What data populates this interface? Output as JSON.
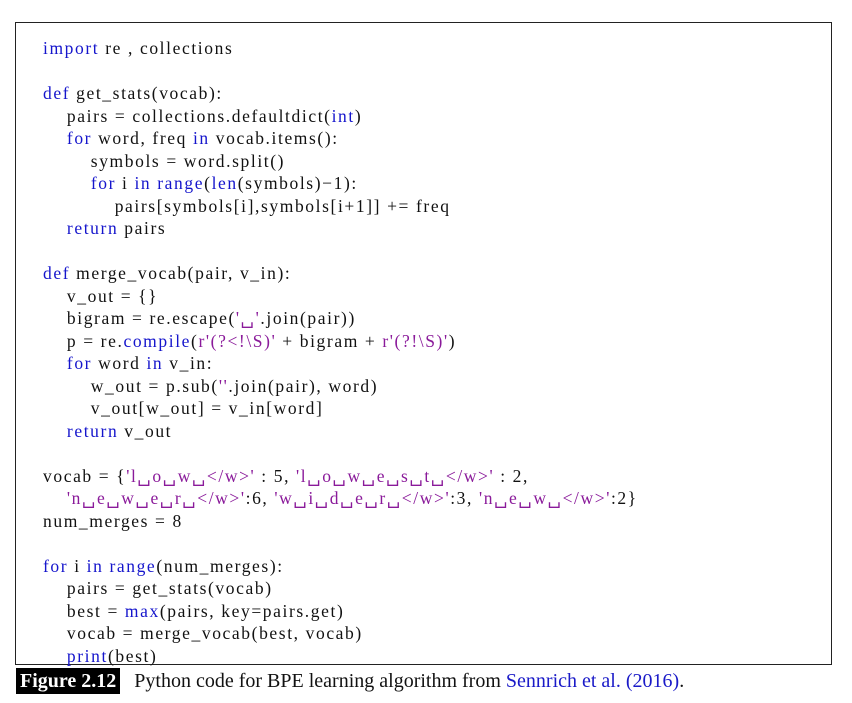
{
  "code_lines": [
    [
      {
        "text": "import",
        "k": "kw"
      },
      {
        "text": " re , collections",
        "k": "tx"
      }
    ],
    [],
    [
      {
        "text": "def",
        "k": "kw"
      },
      {
        "text": " get_stats(vocab):",
        "k": "tx"
      }
    ],
    [
      {
        "text": "    pairs = collections.defaultdict(",
        "k": "tx"
      },
      {
        "text": "int",
        "k": "kw"
      },
      {
        "text": ")",
        "k": "tx"
      }
    ],
    [
      {
        "text": "    ",
        "k": "tx"
      },
      {
        "text": "for",
        "k": "kw"
      },
      {
        "text": " word, freq ",
        "k": "tx"
      },
      {
        "text": "in",
        "k": "kw"
      },
      {
        "text": " vocab.items():",
        "k": "tx"
      }
    ],
    [
      {
        "text": "        symbols = word.split()",
        "k": "tx"
      }
    ],
    [
      {
        "text": "        ",
        "k": "tx"
      },
      {
        "text": "for",
        "k": "kw"
      },
      {
        "text": " i ",
        "k": "tx"
      },
      {
        "text": "in",
        "k": "kw"
      },
      {
        "text": " ",
        "k": "tx"
      },
      {
        "text": "range",
        "k": "kw"
      },
      {
        "text": "(",
        "k": "tx"
      },
      {
        "text": "len",
        "k": "kw"
      },
      {
        "text": "(symbols)−1):",
        "k": "tx"
      }
    ],
    [
      {
        "text": "            pairs[symbols[i],symbols[i+1]] += freq",
        "k": "tx"
      }
    ],
    [
      {
        "text": "    ",
        "k": "tx"
      },
      {
        "text": "return",
        "k": "kw"
      },
      {
        "text": " pairs",
        "k": "tx"
      }
    ],
    [],
    [
      {
        "text": "def",
        "k": "kw"
      },
      {
        "text": " merge_vocab(pair, v_in):",
        "k": "tx"
      }
    ],
    [
      {
        "text": "    v_out = {}",
        "k": "tx"
      }
    ],
    [
      {
        "text": "    bigram = re.escape(",
        "k": "tx"
      },
      {
        "text": "'␣'",
        "k": "st"
      },
      {
        "text": ".join(pair))",
        "k": "tx"
      }
    ],
    [
      {
        "text": "    p = re.",
        "k": "tx"
      },
      {
        "text": "compile",
        "k": "kw"
      },
      {
        "text": "(",
        "k": "tx"
      },
      {
        "text": "r'(?<!\\S)'",
        "k": "st"
      },
      {
        "text": " + bigram + ",
        "k": "tx"
      },
      {
        "text": "r'(?!\\S)'",
        "k": "st"
      },
      {
        "text": ")",
        "k": "tx"
      }
    ],
    [
      {
        "text": "    ",
        "k": "tx"
      },
      {
        "text": "for",
        "k": "kw"
      },
      {
        "text": " word ",
        "k": "tx"
      },
      {
        "text": "in",
        "k": "kw"
      },
      {
        "text": " v_in:",
        "k": "tx"
      }
    ],
    [
      {
        "text": "        w_out = p.sub(",
        "k": "tx"
      },
      {
        "text": "''",
        "k": "st"
      },
      {
        "text": ".join(pair), word)",
        "k": "tx"
      }
    ],
    [
      {
        "text": "        v_out[w_out] = v_in[word]",
        "k": "tx"
      }
    ],
    [
      {
        "text": "    ",
        "k": "tx"
      },
      {
        "text": "return",
        "k": "kw"
      },
      {
        "text": " v_out",
        "k": "tx"
      }
    ],
    [],
    [
      {
        "text": "vocab = {",
        "k": "tx"
      },
      {
        "text": "'l␣o␣w␣</w>'",
        "k": "st"
      },
      {
        "text": " : 5, ",
        "k": "tx"
      },
      {
        "text": "'l␣o␣w␣e␣s␣t␣</w>'",
        "k": "st"
      },
      {
        "text": " : 2,",
        "k": "tx"
      }
    ],
    [
      {
        "text": "    ",
        "k": "tx"
      },
      {
        "text": "'n␣e␣w␣e␣r␣</w>'",
        "k": "st"
      },
      {
        "text": ":6, ",
        "k": "tx"
      },
      {
        "text": "'w␣i␣d␣e␣r␣</w>'",
        "k": "st"
      },
      {
        "text": ":3, ",
        "k": "tx"
      },
      {
        "text": "'n␣e␣w␣</w>'",
        "k": "st"
      },
      {
        "text": ":2}",
        "k": "tx"
      }
    ],
    [
      {
        "text": "num_merges = 8",
        "k": "tx"
      }
    ],
    [],
    [
      {
        "text": "for",
        "k": "kw"
      },
      {
        "text": " i ",
        "k": "tx"
      },
      {
        "text": "in",
        "k": "kw"
      },
      {
        "text": " ",
        "k": "tx"
      },
      {
        "text": "range",
        "k": "kw"
      },
      {
        "text": "(num_merges):",
        "k": "tx"
      }
    ],
    [
      {
        "text": "    pairs = get_stats(vocab)",
        "k": "tx"
      }
    ],
    [
      {
        "text": "    best = ",
        "k": "tx"
      },
      {
        "text": "max",
        "k": "kw"
      },
      {
        "text": "(pairs, key=pairs.get)",
        "k": "tx"
      }
    ],
    [
      {
        "text": "    vocab = merge_vocab(best, vocab)",
        "k": "tx"
      }
    ],
    [
      {
        "text": "    ",
        "k": "tx"
      },
      {
        "text": "print",
        "k": "kw"
      },
      {
        "text": "(best)",
        "k": "tx"
      }
    ]
  ],
  "caption": {
    "label": "Figure 2.12",
    "text": "Python code for BPE learning algorithm from ",
    "citation": "Sennrich et al. (2016)",
    "end": "."
  },
  "colors": {
    "keyword": "#1515cc",
    "string": "#8a1a9a",
    "text": "#111111",
    "citation": "#1a1ac8",
    "label_background": "#000000"
  }
}
